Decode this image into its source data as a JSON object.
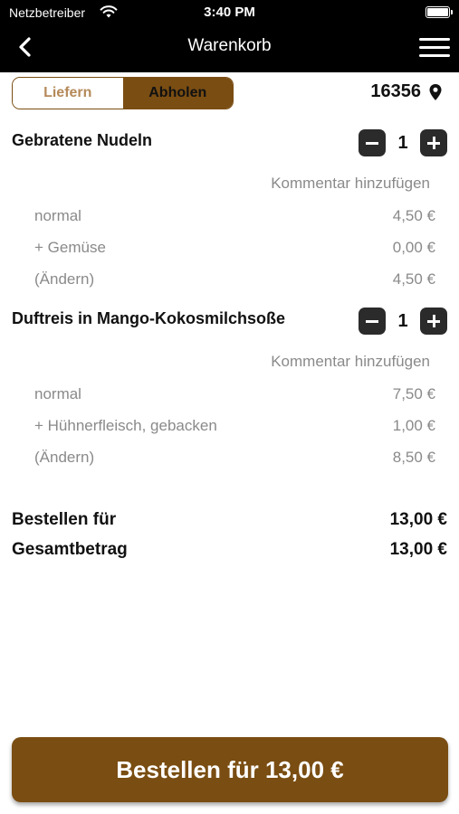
{
  "status_bar": {
    "carrier": "Netzbetreiber",
    "time": "3:40 PM"
  },
  "nav": {
    "title": "Warenkorb",
    "back_icon": "chevron-left-icon",
    "menu_icon": "hamburger-menu-icon"
  },
  "mode": {
    "options": [
      "Liefern",
      "Abholen"
    ],
    "selected": "Abholen"
  },
  "store": {
    "code": "16356",
    "icon": "location-pin-icon"
  },
  "cart": {
    "items": [
      {
        "name": "Gebratene Nudeln",
        "quantity": "1",
        "comment_label": "Kommentar hinzufügen",
        "lines": [
          {
            "label": "normal",
            "price": "4,50 €"
          },
          {
            "label": "+ Gemüse",
            "price": "0,00 €"
          },
          {
            "label": "(Ändern)",
            "price": "4,50 €"
          }
        ]
      },
      {
        "name": "Duftreis in Mango-Kokosmilchsoße",
        "quantity": "1",
        "comment_label": "Kommentar hinzufügen",
        "lines": [
          {
            "label": "normal",
            "price": "7,50 €"
          },
          {
            "label": "+ Hühnerfleisch, gebacken",
            "price": "1,00 €"
          },
          {
            "label": "(Ändern)",
            "price": "8,50 €"
          }
        ]
      }
    ]
  },
  "totals": {
    "order_for_label": "Bestellen für",
    "order_for_value": "13,00 €",
    "total_label": "Gesamtbetrag",
    "total_value": "13,00 €"
  },
  "order_button": {
    "label": "Bestellen für 13,00 €"
  },
  "colors": {
    "accent": "#7a4d12",
    "bar": "#000000",
    "muted_text": "#8a8a8a"
  }
}
